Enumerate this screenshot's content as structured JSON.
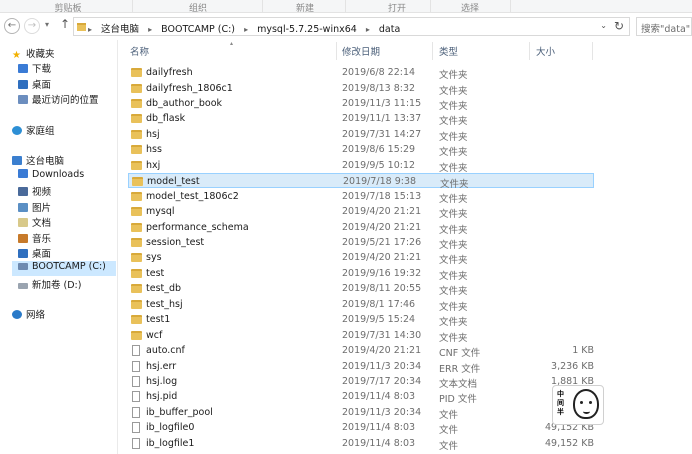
{
  "ribbon": {
    "groups": [
      "剪贴板",
      "组织",
      "新建",
      "打开",
      "选择"
    ]
  },
  "navbar": {
    "back_icon": "arrow-left",
    "forward_icon": "arrow-right",
    "up_icon": "arrow-up",
    "breadcrumbs": [
      "这台电脑",
      "BOOTCAMP (C:)",
      "mysql-5.7.25-winx64",
      "data"
    ],
    "search_placeholder": "搜索\"data\""
  },
  "navpane": {
    "quick_access": "收藏夹",
    "favorites": [
      "下载",
      "桌面",
      "最近访问的位置"
    ],
    "homegroup": "家庭组",
    "this_pc": "这台电脑",
    "pc_items": [
      "Downloads",
      "视频",
      "图片",
      "文档",
      "音乐",
      "桌面",
      "BOOTCAMP (C:)",
      "新加卷 (D:)"
    ],
    "selected_drive": "BOOTCAMP (C:)",
    "network": "网络"
  },
  "list": {
    "columns": {
      "name": "名称",
      "date": "修改日期",
      "type": "类型",
      "size": "大小"
    },
    "selected_row": "model_test",
    "rows": [
      {
        "name": "dailyfresh",
        "date": "2019/6/8 22:14",
        "type": "文件夹",
        "size": "",
        "kind": "folder"
      },
      {
        "name": "dailyfresh_1806c1",
        "date": "2019/8/13 8:32",
        "type": "文件夹",
        "size": "",
        "kind": "folder"
      },
      {
        "name": "db_author_book",
        "date": "2019/11/3 11:15",
        "type": "文件夹",
        "size": "",
        "kind": "folder"
      },
      {
        "name": "db_flask",
        "date": "2019/11/1 13:37",
        "type": "文件夹",
        "size": "",
        "kind": "folder"
      },
      {
        "name": "hsj",
        "date": "2019/7/31 14:27",
        "type": "文件夹",
        "size": "",
        "kind": "folder"
      },
      {
        "name": "hss",
        "date": "2019/8/6 15:29",
        "type": "文件夹",
        "size": "",
        "kind": "folder"
      },
      {
        "name": "hxj",
        "date": "2019/9/5 10:12",
        "type": "文件夹",
        "size": "",
        "kind": "folder"
      },
      {
        "name": "model_test",
        "date": "2019/7/18 9:38",
        "type": "文件夹",
        "size": "",
        "kind": "folder"
      },
      {
        "name": "model_test_1806c2",
        "date": "2019/7/18 15:13",
        "type": "文件夹",
        "size": "",
        "kind": "folder"
      },
      {
        "name": "mysql",
        "date": "2019/4/20 21:21",
        "type": "文件夹",
        "size": "",
        "kind": "folder"
      },
      {
        "name": "performance_schema",
        "date": "2019/4/20 21:21",
        "type": "文件夹",
        "size": "",
        "kind": "folder"
      },
      {
        "name": "session_test",
        "date": "2019/5/21 17:26",
        "type": "文件夹",
        "size": "",
        "kind": "folder"
      },
      {
        "name": "sys",
        "date": "2019/4/20 21:21",
        "type": "文件夹",
        "size": "",
        "kind": "folder"
      },
      {
        "name": "test",
        "date": "2019/9/16 19:32",
        "type": "文件夹",
        "size": "",
        "kind": "folder"
      },
      {
        "name": "test_db",
        "date": "2019/8/11 20:55",
        "type": "文件夹",
        "size": "",
        "kind": "folder"
      },
      {
        "name": "test_hsj",
        "date": "2019/8/1 17:46",
        "type": "文件夹",
        "size": "",
        "kind": "folder"
      },
      {
        "name": "test1",
        "date": "2019/9/5 15:24",
        "type": "文件夹",
        "size": "",
        "kind": "folder"
      },
      {
        "name": "wcf",
        "date": "2019/7/31 14:30",
        "type": "文件夹",
        "size": "",
        "kind": "folder"
      },
      {
        "name": "auto.cnf",
        "date": "2019/4/20 21:21",
        "type": "CNF 文件",
        "size": "1 KB",
        "kind": "file"
      },
      {
        "name": "hsj.err",
        "date": "2019/11/3 20:34",
        "type": "ERR 文件",
        "size": "3,236 KB",
        "kind": "file"
      },
      {
        "name": "hsj.log",
        "date": "2019/7/17 20:34",
        "type": "文本文档",
        "size": "1,881 KB",
        "kind": "file"
      },
      {
        "name": "hsj.pid",
        "date": "2019/11/4 8:03",
        "type": "PID 文件",
        "size": "",
        "kind": "file"
      },
      {
        "name": "ib_buffer_pool",
        "date": "2019/11/3 20:34",
        "type": "文件",
        "size": "",
        "kind": "file"
      },
      {
        "name": "ib_logfile0",
        "date": "2019/11/4 8:03",
        "type": "文件",
        "size": "49,152 KB",
        "kind": "file"
      },
      {
        "name": "ib_logfile1",
        "date": "2019/11/4 8:03",
        "type": "文件",
        "size": "49,152 KB",
        "kind": "file"
      }
    ]
  },
  "sticker": {
    "text": "中间半"
  }
}
